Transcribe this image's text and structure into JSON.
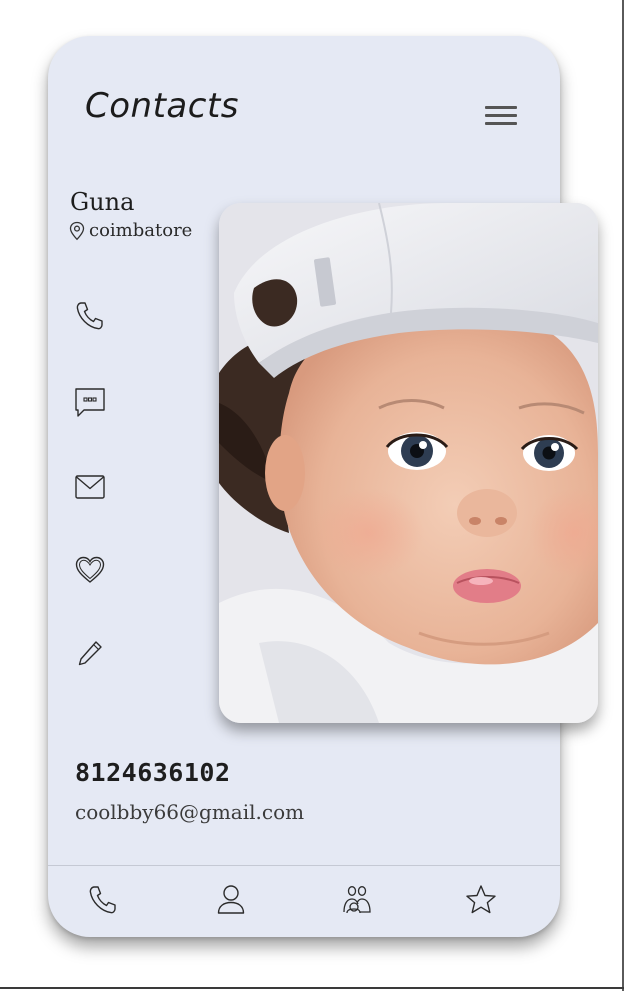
{
  "header": {
    "title": "Contacts",
    "menu_icon": "hamburger-menu-icon"
  },
  "contact": {
    "name": "Guna",
    "location": "coimbatore",
    "phone": "8124636102",
    "email": "coolbby66@gmail.com"
  },
  "actions": [
    {
      "icon": "phone-icon"
    },
    {
      "icon": "message-icon"
    },
    {
      "icon": "mail-icon"
    },
    {
      "icon": "heart-icon"
    },
    {
      "icon": "edit-icon"
    }
  ],
  "bottom_nav": [
    {
      "icon": "phone-icon"
    },
    {
      "icon": "person-icon"
    },
    {
      "icon": "group-icon"
    },
    {
      "icon": "star-icon"
    }
  ],
  "colors": {
    "card_background": "#e5e9f4",
    "icon_stroke": "#2b2b2b",
    "text": "#1d1d1d"
  }
}
